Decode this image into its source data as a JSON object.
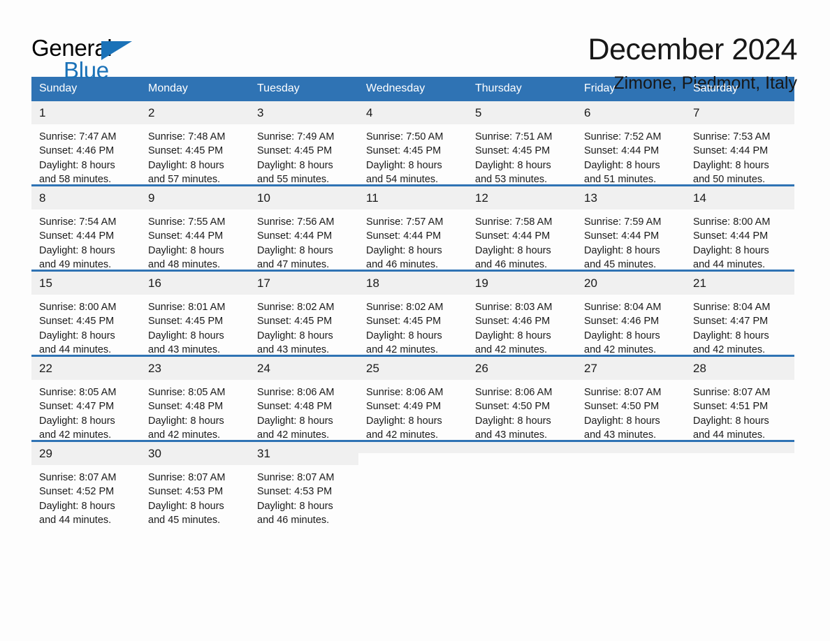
{
  "brand": {
    "name_part1": "General",
    "name_part2": "Blue",
    "triangle_icon": "blue-triangle-logo-mark",
    "accent_color": "#1b72b8"
  },
  "header": {
    "month_title": "December 2024",
    "location": "Zimone, Piedmont, Italy"
  },
  "theme": {
    "header_blue": "#2f73b4",
    "daynum_gray": "#f0f0f0",
    "page_background": "#fdfdfd"
  },
  "calendar": {
    "weekday_headers": [
      "Sunday",
      "Monday",
      "Tuesday",
      "Wednesday",
      "Thursday",
      "Friday",
      "Saturday"
    ],
    "weeks": [
      [
        {
          "day": "1",
          "info": "Sunrise: 7:47 AM\nSunset: 4:46 PM\nDaylight: 8 hours\nand 58 minutes."
        },
        {
          "day": "2",
          "info": "Sunrise: 7:48 AM\nSunset: 4:45 PM\nDaylight: 8 hours\nand 57 minutes."
        },
        {
          "day": "3",
          "info": "Sunrise: 7:49 AM\nSunset: 4:45 PM\nDaylight: 8 hours\nand 55 minutes."
        },
        {
          "day": "4",
          "info": "Sunrise: 7:50 AM\nSunset: 4:45 PM\nDaylight: 8 hours\nand 54 minutes."
        },
        {
          "day": "5",
          "info": "Sunrise: 7:51 AM\nSunset: 4:45 PM\nDaylight: 8 hours\nand 53 minutes."
        },
        {
          "day": "6",
          "info": "Sunrise: 7:52 AM\nSunset: 4:44 PM\nDaylight: 8 hours\nand 51 minutes."
        },
        {
          "day": "7",
          "info": "Sunrise: 7:53 AM\nSunset: 4:44 PM\nDaylight: 8 hours\nand 50 minutes."
        }
      ],
      [
        {
          "day": "8",
          "info": "Sunrise: 7:54 AM\nSunset: 4:44 PM\nDaylight: 8 hours\nand 49 minutes."
        },
        {
          "day": "9",
          "info": "Sunrise: 7:55 AM\nSunset: 4:44 PM\nDaylight: 8 hours\nand 48 minutes."
        },
        {
          "day": "10",
          "info": "Sunrise: 7:56 AM\nSunset: 4:44 PM\nDaylight: 8 hours\nand 47 minutes."
        },
        {
          "day": "11",
          "info": "Sunrise: 7:57 AM\nSunset: 4:44 PM\nDaylight: 8 hours\nand 46 minutes."
        },
        {
          "day": "12",
          "info": "Sunrise: 7:58 AM\nSunset: 4:44 PM\nDaylight: 8 hours\nand 46 minutes."
        },
        {
          "day": "13",
          "info": "Sunrise: 7:59 AM\nSunset: 4:44 PM\nDaylight: 8 hours\nand 45 minutes."
        },
        {
          "day": "14",
          "info": "Sunrise: 8:00 AM\nSunset: 4:44 PM\nDaylight: 8 hours\nand 44 minutes."
        }
      ],
      [
        {
          "day": "15",
          "info": "Sunrise: 8:00 AM\nSunset: 4:45 PM\nDaylight: 8 hours\nand 44 minutes."
        },
        {
          "day": "16",
          "info": "Sunrise: 8:01 AM\nSunset: 4:45 PM\nDaylight: 8 hours\nand 43 minutes."
        },
        {
          "day": "17",
          "info": "Sunrise: 8:02 AM\nSunset: 4:45 PM\nDaylight: 8 hours\nand 43 minutes."
        },
        {
          "day": "18",
          "info": "Sunrise: 8:02 AM\nSunset: 4:45 PM\nDaylight: 8 hours\nand 42 minutes."
        },
        {
          "day": "19",
          "info": "Sunrise: 8:03 AM\nSunset: 4:46 PM\nDaylight: 8 hours\nand 42 minutes."
        },
        {
          "day": "20",
          "info": "Sunrise: 8:04 AM\nSunset: 4:46 PM\nDaylight: 8 hours\nand 42 minutes."
        },
        {
          "day": "21",
          "info": "Sunrise: 8:04 AM\nSunset: 4:47 PM\nDaylight: 8 hours\nand 42 minutes."
        }
      ],
      [
        {
          "day": "22",
          "info": "Sunrise: 8:05 AM\nSunset: 4:47 PM\nDaylight: 8 hours\nand 42 minutes."
        },
        {
          "day": "23",
          "info": "Sunrise: 8:05 AM\nSunset: 4:48 PM\nDaylight: 8 hours\nand 42 minutes."
        },
        {
          "day": "24",
          "info": "Sunrise: 8:06 AM\nSunset: 4:48 PM\nDaylight: 8 hours\nand 42 minutes."
        },
        {
          "day": "25",
          "info": "Sunrise: 8:06 AM\nSunset: 4:49 PM\nDaylight: 8 hours\nand 42 minutes."
        },
        {
          "day": "26",
          "info": "Sunrise: 8:06 AM\nSunset: 4:50 PM\nDaylight: 8 hours\nand 43 minutes."
        },
        {
          "day": "27",
          "info": "Sunrise: 8:07 AM\nSunset: 4:50 PM\nDaylight: 8 hours\nand 43 minutes."
        },
        {
          "day": "28",
          "info": "Sunrise: 8:07 AM\nSunset: 4:51 PM\nDaylight: 8 hours\nand 44 minutes."
        }
      ],
      [
        {
          "day": "29",
          "info": "Sunrise: 8:07 AM\nSunset: 4:52 PM\nDaylight: 8 hours\nand 44 minutes."
        },
        {
          "day": "30",
          "info": "Sunrise: 8:07 AM\nSunset: 4:53 PM\nDaylight: 8 hours\nand 45 minutes."
        },
        {
          "day": "31",
          "info": "Sunrise: 8:07 AM\nSunset: 4:53 PM\nDaylight: 8 hours\nand 46 minutes."
        },
        {
          "day": "",
          "info": ""
        },
        {
          "day": "",
          "info": ""
        },
        {
          "day": "",
          "info": ""
        },
        {
          "day": "",
          "info": ""
        }
      ]
    ]
  }
}
